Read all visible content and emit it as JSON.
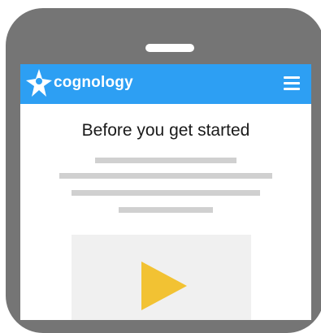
{
  "app": {
    "brand_name": "cognology",
    "header_color": "#2d9ff3",
    "logo_icon": "star-person-icon",
    "menu_icon": "hamburger-menu-icon"
  },
  "content": {
    "title": "Before you get started",
    "placeholder_lines": 4,
    "video": {
      "play_icon": "play-icon",
      "play_color": "#f2c233"
    }
  }
}
